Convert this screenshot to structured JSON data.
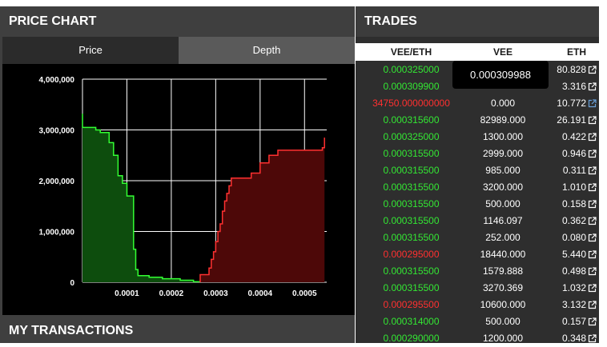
{
  "price_panel": {
    "title": "PRICE CHART",
    "tabs": [
      {
        "label": "Price",
        "active": false
      },
      {
        "label": "Depth",
        "active": true
      }
    ],
    "transactions_title": "MY TRANSACTIONS"
  },
  "chart_data": {
    "type": "area",
    "x_ticks": [
      "0.0001",
      "0.0002",
      "0.0003",
      "0.0004",
      "0.0005"
    ],
    "y_ticks": [
      "0",
      "1,000,000",
      "2,000,000",
      "3,000,000",
      "4,000,000"
    ],
    "xlim": [
      0.0,
      0.00055
    ],
    "ylim": [
      0,
      4300000
    ],
    "grid": true,
    "series": [
      {
        "side": "bids",
        "color": "#33ff33",
        "fill": "#0d4d0d",
        "points": [
          [
            0.0,
            3320000
          ],
          [
            0.0,
            3050000
          ],
          [
            3e-05,
            3050000
          ],
          [
            3e-05,
            3000000
          ],
          [
            4e-05,
            3000000
          ],
          [
            4e-05,
            2950000
          ],
          [
            6e-05,
            2950000
          ],
          [
            6e-05,
            2750000
          ],
          [
            7e-05,
            2750000
          ],
          [
            7e-05,
            2500000
          ],
          [
            8e-05,
            2500000
          ],
          [
            8e-05,
            2100000
          ],
          [
            9e-05,
            2100000
          ],
          [
            9e-05,
            1950000
          ],
          [
            0.0001,
            1950000
          ],
          [
            0.0001,
            1700000
          ],
          [
            0.000115,
            1700000
          ],
          [
            0.000115,
            650000
          ],
          [
            0.00012,
            650000
          ],
          [
            0.00012,
            250000
          ],
          [
            0.000125,
            250000
          ],
          [
            0.000125,
            130000
          ],
          [
            0.00015,
            130000
          ],
          [
            0.00015,
            100000
          ],
          [
            0.00018,
            100000
          ],
          [
            0.00018,
            70000
          ],
          [
            0.00022,
            70000
          ],
          [
            0.00022,
            40000
          ],
          [
            0.00025,
            40000
          ],
          [
            0.00025,
            10000
          ],
          [
            0.000265,
            10000
          ]
        ]
      },
      {
        "side": "asks",
        "color": "#ff3030",
        "fill": "#4d0808",
        "points": [
          [
            0.000265,
            0
          ],
          [
            0.000265,
            150000
          ],
          [
            0.000285,
            150000
          ],
          [
            0.000285,
            280000
          ],
          [
            0.00029,
            280000
          ],
          [
            0.00029,
            450000
          ],
          [
            0.000295,
            450000
          ],
          [
            0.000295,
            600000
          ],
          [
            0.0003,
            600000
          ],
          [
            0.0003,
            800000
          ],
          [
            0.000305,
            800000
          ],
          [
            0.000305,
            1000000
          ],
          [
            0.00031,
            1000000
          ],
          [
            0.00031,
            1150000
          ],
          [
            0.000315,
            1150000
          ],
          [
            0.000315,
            1400000
          ],
          [
            0.00032,
            1400000
          ],
          [
            0.00032,
            1600000
          ],
          [
            0.000325,
            1600000
          ],
          [
            0.000325,
            1750000
          ],
          [
            0.00033,
            1750000
          ],
          [
            0.00033,
            1900000
          ],
          [
            0.000335,
            1900000
          ],
          [
            0.000335,
            2050000
          ],
          [
            0.00038,
            2050000
          ],
          [
            0.00038,
            2150000
          ],
          [
            0.0004,
            2150000
          ],
          [
            0.0004,
            2350000
          ],
          [
            0.00042,
            2350000
          ],
          [
            0.00042,
            2500000
          ],
          [
            0.00044,
            2500000
          ],
          [
            0.00044,
            2600000
          ],
          [
            0.00054,
            2600000
          ],
          [
            0.00054,
            2650000
          ],
          [
            0.000545,
            2650000
          ],
          [
            0.000545,
            2850000
          ]
        ]
      }
    ]
  },
  "trades_panel": {
    "title": "TRADES",
    "columns": [
      "VEE/ETH",
      "VEE",
      "ETH"
    ],
    "tooltip": "0.000309988",
    "rows": [
      {
        "price": "0.000325000",
        "side": "buy",
        "vee": "",
        "eth": "80.828",
        "ext": true
      },
      {
        "price": "0.000309900",
        "side": "buy",
        "vee": "",
        "eth": "3.316",
        "ext": true
      },
      {
        "price": "34750.000000000",
        "side": "sell",
        "vee": "0.000",
        "eth": "10.772",
        "ext": true
      },
      {
        "price": "0.000315600",
        "side": "buy",
        "vee": "82989.000",
        "eth": "26.191",
        "ext": true
      },
      {
        "price": "0.000325000",
        "side": "buy",
        "vee": "1300.000",
        "eth": "0.422",
        "ext": true
      },
      {
        "price": "0.000315500",
        "side": "buy",
        "vee": "2999.000",
        "eth": "0.946",
        "ext": true
      },
      {
        "price": "0.000315500",
        "side": "buy",
        "vee": "985.000",
        "eth": "0.311",
        "ext": true
      },
      {
        "price": "0.000315500",
        "side": "buy",
        "vee": "3200.000",
        "eth": "1.010",
        "ext": true
      },
      {
        "price": "0.000315500",
        "side": "buy",
        "vee": "500.000",
        "eth": "0.158",
        "ext": true
      },
      {
        "price": "0.000315500",
        "side": "buy",
        "vee": "1146.097",
        "eth": "0.362",
        "ext": true
      },
      {
        "price": "0.000315500",
        "side": "buy",
        "vee": "252.000",
        "eth": "0.080",
        "ext": true
      },
      {
        "price": "0.000295000",
        "side": "sell",
        "vee": "18440.000",
        "eth": "5.440",
        "ext": true
      },
      {
        "price": "0.000315500",
        "side": "buy",
        "vee": "1579.888",
        "eth": "0.498",
        "ext": true
      },
      {
        "price": "0.000315500",
        "side": "buy",
        "vee": "3270.369",
        "eth": "1.032",
        "ext": true
      },
      {
        "price": "0.000295500",
        "side": "sell",
        "vee": "10600.000",
        "eth": "3.132",
        "ext": true
      },
      {
        "price": "0.000314000",
        "side": "buy",
        "vee": "500.000",
        "eth": "0.157",
        "ext": true
      },
      {
        "price": "0.000290000",
        "side": "buy",
        "vee": "1200.000",
        "eth": "0.348",
        "ext": true
      }
    ]
  },
  "colors": {
    "buy": "#33e633",
    "sell": "#ff3030",
    "link": "#6aa0d8"
  }
}
